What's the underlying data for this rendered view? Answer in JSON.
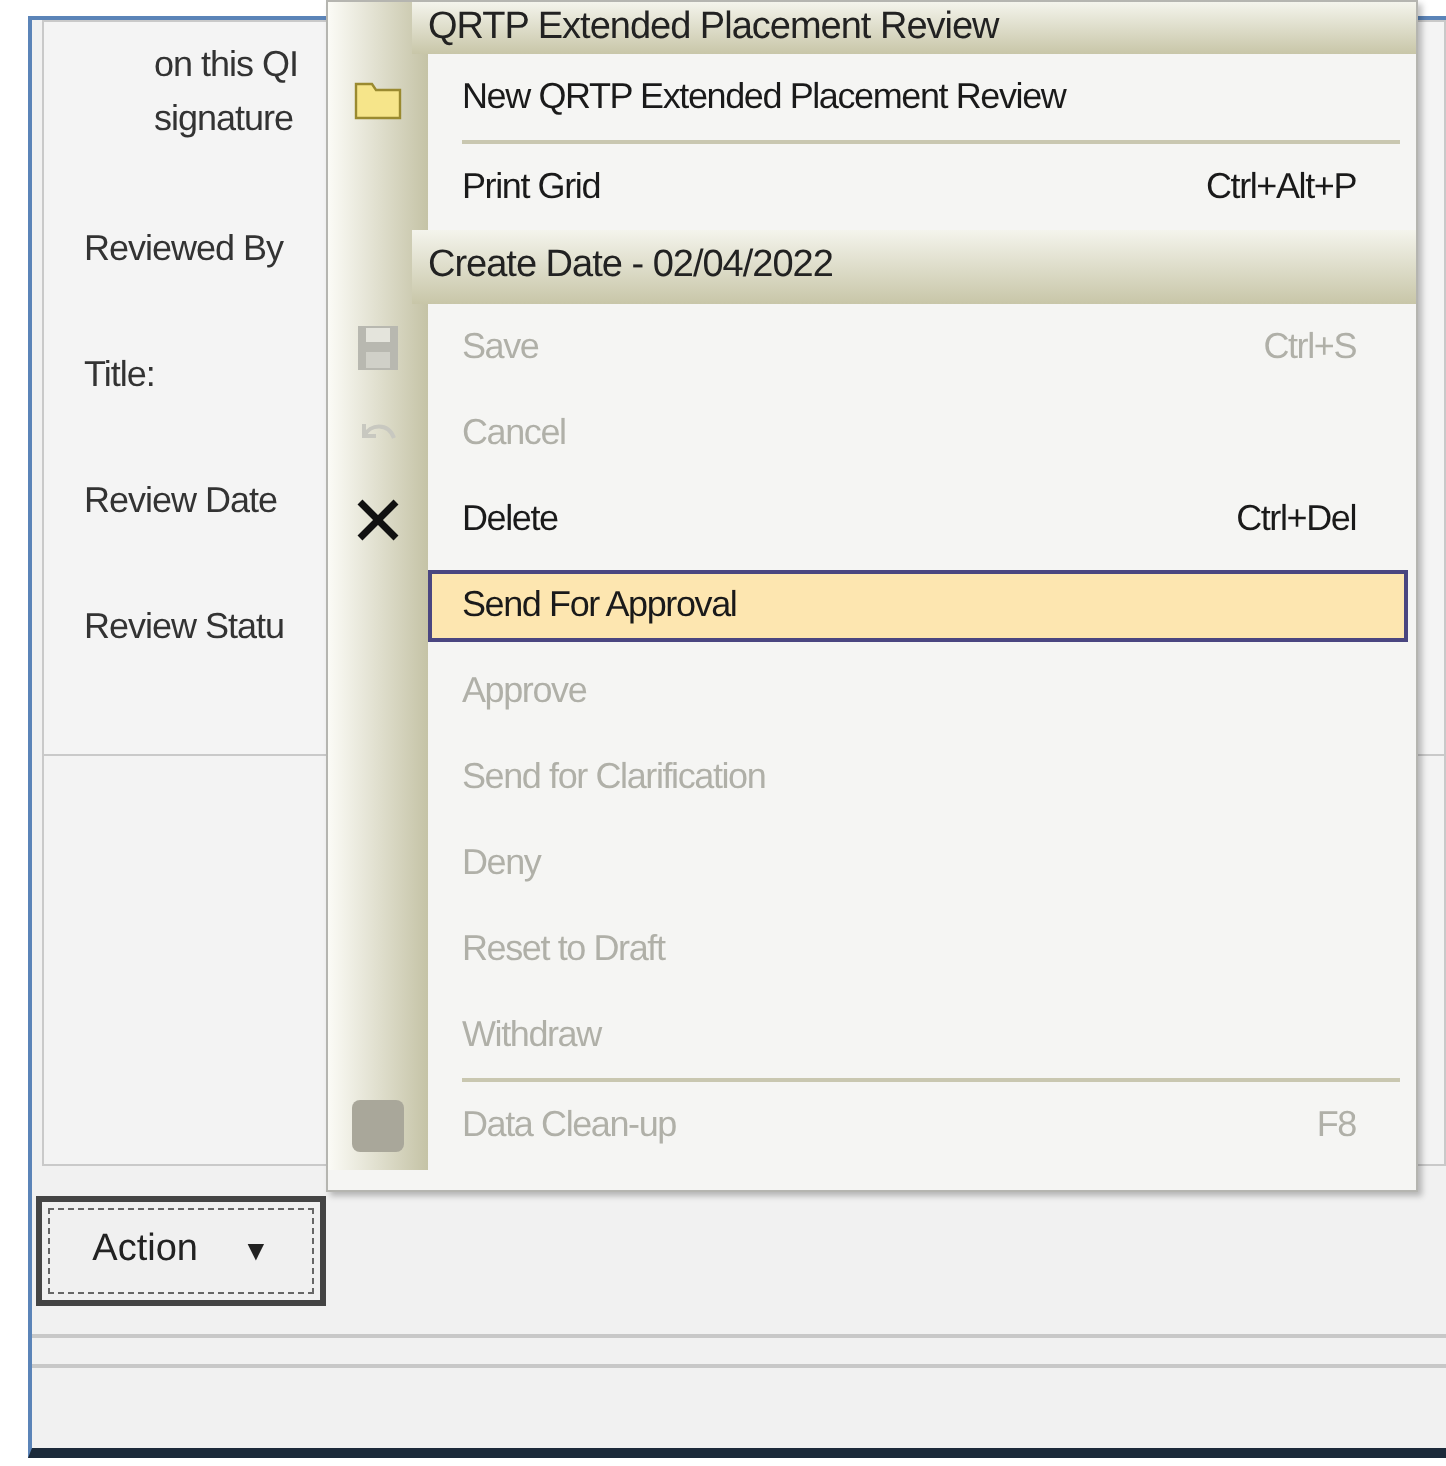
{
  "form": {
    "labels": [
      "on this QI",
      "signature",
      "Reviewed By",
      "Title:",
      "Review Date",
      "Review Statu"
    ]
  },
  "menu": {
    "items": [
      {
        "kind": "header",
        "label": "QRTP Extended Placement Review"
      },
      {
        "kind": "item",
        "label": "New QRTP Extended Placement Review",
        "disabled": false,
        "selected": false
      },
      {
        "kind": "separator"
      },
      {
        "kind": "item",
        "label": "Print Grid",
        "shortcut": "Ctrl+Alt+P",
        "disabled": false,
        "selected": false
      },
      {
        "kind": "header",
        "label": "Create Date - 02/04/2022"
      },
      {
        "kind": "item",
        "label": "Save",
        "shortcut": "Ctrl+S",
        "disabled": true,
        "selected": false
      },
      {
        "kind": "item",
        "label": "Cancel",
        "disabled": true,
        "selected": false
      },
      {
        "kind": "item",
        "label": "Delete",
        "shortcut": "Ctrl+Del",
        "disabled": false,
        "selected": false
      },
      {
        "kind": "item",
        "label": "Send For Approval",
        "disabled": false,
        "selected": true
      },
      {
        "kind": "item",
        "label": "Approve",
        "disabled": true,
        "selected": false
      },
      {
        "kind": "item",
        "label": "Send for Clarification",
        "disabled": true,
        "selected": false
      },
      {
        "kind": "item",
        "label": "Deny",
        "disabled": true,
        "selected": false
      },
      {
        "kind": "item",
        "label": "Reset to Draft",
        "disabled": true,
        "selected": false
      },
      {
        "kind": "item",
        "label": "Withdraw",
        "disabled": true,
        "selected": false
      },
      {
        "kind": "separator"
      },
      {
        "kind": "item",
        "label": "Data Clean-up",
        "shortcut": "F8",
        "disabled": true,
        "selected": false
      }
    ]
  },
  "action_button": {
    "label": "Action",
    "caret": "▼"
  }
}
